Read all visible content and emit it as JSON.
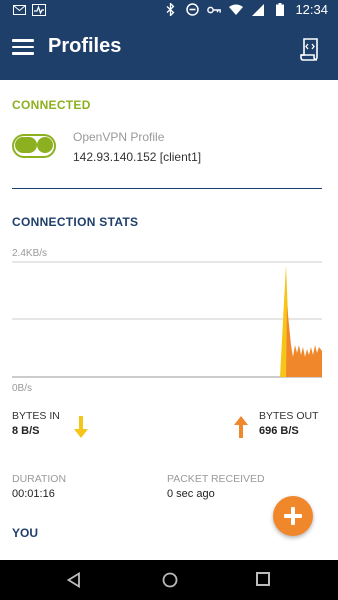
{
  "status_bar": {
    "time": "12:34",
    "left_icons": [
      "mail-icon",
      "pulse-icon"
    ],
    "right_icons": [
      "bluetooth-icon",
      "minus-circle-icon",
      "vpn-key-icon",
      "wifi-icon",
      "signal-icon",
      "battery-icon"
    ]
  },
  "app_bar": {
    "title": "Profiles",
    "menu_icon": "hamburger-menu-icon",
    "import_icon": "import-profile-icon"
  },
  "connection": {
    "status_label": "CONNECTED",
    "toggle_on": true,
    "profile_name": "OpenVPN Profile",
    "profile_server": "142.93.140.152 [client1]"
  },
  "stats": {
    "section_label": "CONNECTION STATS",
    "chart_max_label": "2.4KB/s",
    "chart_min_label": "0B/s",
    "bytes_in_label": "BYTES IN",
    "bytes_in_value": "8 B/S",
    "bytes_out_label": "BYTES OUT",
    "bytes_out_value": "696 B/S",
    "duration_label": "DURATION",
    "duration_value": "00:01:16",
    "packet_label": "PACKET RECEIVED",
    "packet_value": "0 sec ago",
    "you_label": "YOU"
  },
  "colors": {
    "primary": "#1f3f6b",
    "connected_green": "#8db020",
    "accent_orange": "#f0872a",
    "arrow_in_yellow": "#f5c518"
  }
}
